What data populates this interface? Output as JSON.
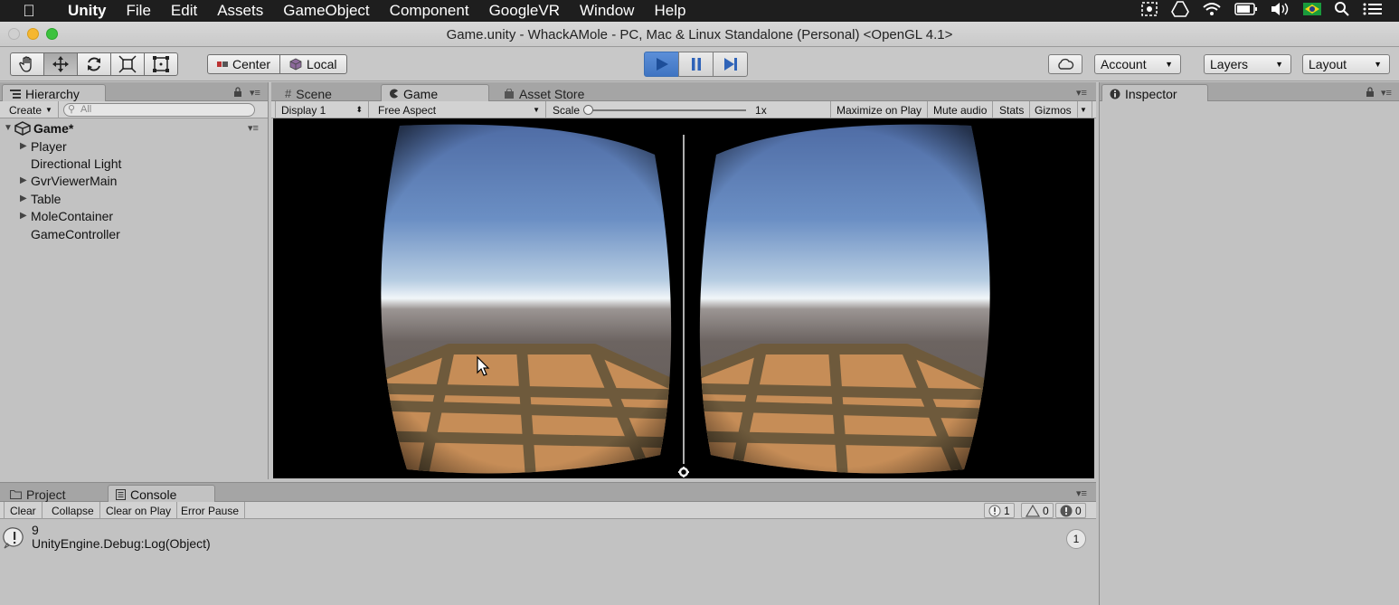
{
  "menubar": {
    "app": "Unity",
    "items": [
      "File",
      "Edit",
      "Assets",
      "GameObject",
      "Component",
      "GoogleVR",
      "Window",
      "Help"
    ]
  },
  "window": {
    "title": "Game.unity - WhackAMole - PC, Mac & Linux Standalone (Personal) <OpenGL 4.1>"
  },
  "toolbar": {
    "pivot_center": "Center",
    "pivot_local": "Local",
    "account": "Account",
    "layers": "Layers",
    "layout": "Layout"
  },
  "hierarchy": {
    "tab": "Hierarchy",
    "create": "Create",
    "search_placeholder": "All",
    "scene": "Game*",
    "items": [
      {
        "label": "Player",
        "expandable": true
      },
      {
        "label": "Directional Light",
        "expandable": false
      },
      {
        "label": "GvrViewerMain",
        "expandable": true
      },
      {
        "label": "Table",
        "expandable": true
      },
      {
        "label": "MoleContainer",
        "expandable": true
      },
      {
        "label": "GameController",
        "expandable": false
      }
    ]
  },
  "gameview": {
    "tabs": [
      "Scene",
      "Game",
      "Asset Store"
    ],
    "display": "Display 1",
    "aspect": "Free Aspect",
    "scale_label": "Scale",
    "scale_value": "1x",
    "maximize": "Maximize on Play",
    "mute": "Mute audio",
    "stats": "Stats",
    "gizmos": "Gizmos"
  },
  "inspector": {
    "tab": "Inspector"
  },
  "console": {
    "tabs": [
      "Project",
      "Console"
    ],
    "clear": "Clear",
    "collapse": "Collapse",
    "clear_on_play": "Clear on Play",
    "error_pause": "Error Pause",
    "log_count": "1",
    "warn_count": "0",
    "error_count": "0",
    "entry_line1": "9",
    "entry_line2": "UnityEngine.Debug:Log(Object)",
    "entry_count": "1"
  },
  "colors": {
    "play_active": "#4a7fcc",
    "sky_top": "#4f6fa8",
    "horizon": "#eef4f8",
    "ground": "#6b6461",
    "table_wood": "#c9915a"
  }
}
